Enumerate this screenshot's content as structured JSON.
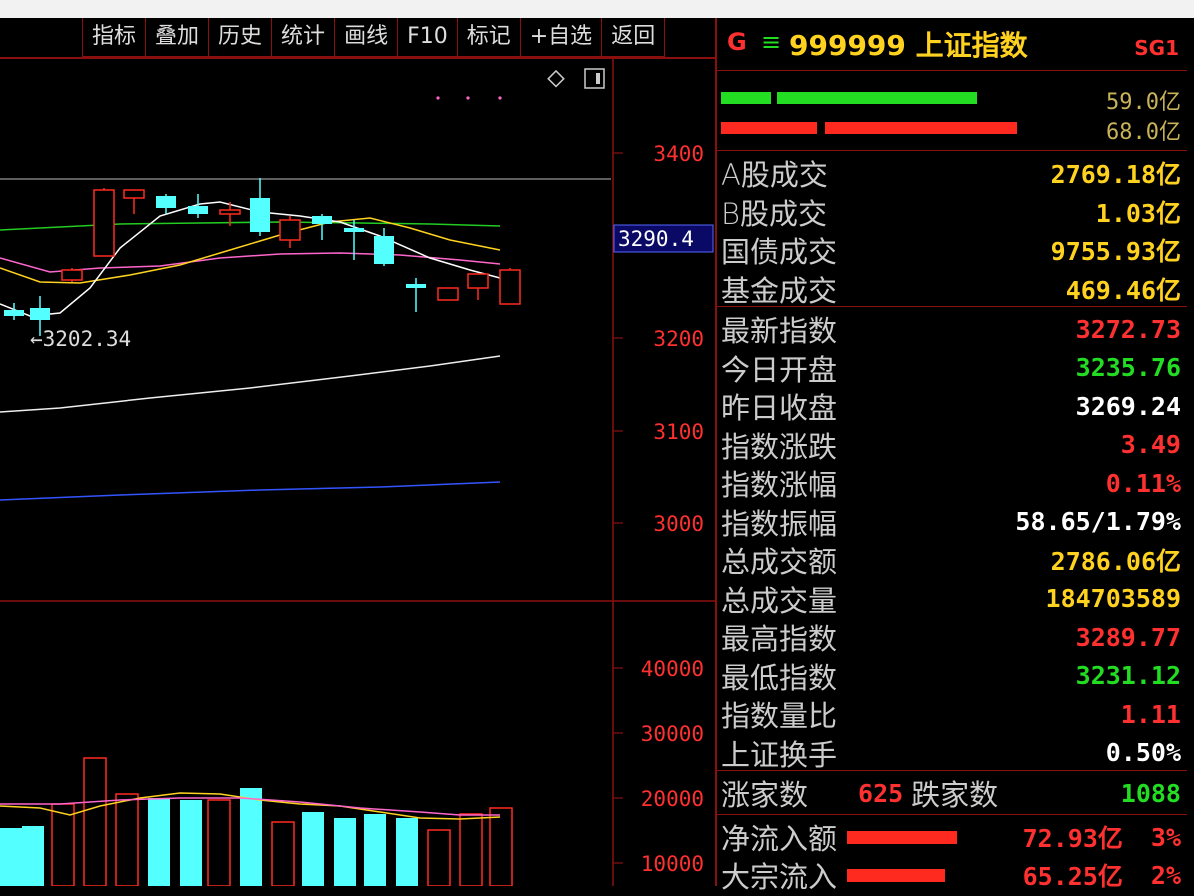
{
  "toolbar": {
    "buttons": [
      "指标",
      "叠加",
      "历史",
      "统计",
      "画线",
      "F10",
      "标记",
      "+自选",
      "返回"
    ]
  },
  "chart": {
    "price_ticks": [
      "3400",
      "3200",
      "3100",
      "3000"
    ],
    "current_price": "3290.4",
    "low_annotation": "←3202.34",
    "volume_ticks": [
      "40000",
      "30000",
      "20000",
      "10000"
    ],
    "colors": {
      "up": "#ff2a1f",
      "down": "#54ffff",
      "ma5": "#ffffff",
      "ma10": "#ffd21f",
      "ma20": "#ff66cc",
      "ma30": "#22cc22",
      "ma60": "#eeeeee",
      "ma120": "#3355ff"
    }
  },
  "header": {
    "g": "G",
    "menu": "≡",
    "title": "999999 上证指数",
    "sg": "SG1"
  },
  "ratio_bars": {
    "green_value": "59.0亿",
    "red_value": "68.0亿"
  },
  "turnover": [
    {
      "label": "A股成交",
      "value": "2769.18亿",
      "color": "#ffd21f"
    },
    {
      "label": "B股成交",
      "value": "1.03亿",
      "color": "#ffd21f"
    },
    {
      "label": "国债成交",
      "value": "9755.93亿",
      "color": "#ffd21f"
    },
    {
      "label": "基金成交",
      "value": "469.46亿",
      "color": "#ffd21f"
    }
  ],
  "index_stats": [
    {
      "label": "最新指数",
      "value": "3272.73",
      "color": "#ff3030"
    },
    {
      "label": "今日开盘",
      "value": "3235.76",
      "color": "#22dd22"
    },
    {
      "label": "昨日收盘",
      "value": "3269.24",
      "color": "#ffffff"
    },
    {
      "label": "指数涨跌",
      "value": "3.49",
      "color": "#ff3030"
    },
    {
      "label": "指数涨幅",
      "value": "0.11%",
      "color": "#ff3030"
    },
    {
      "label": "指数振幅",
      "value": "58.65/1.79%",
      "color": "#ffffff"
    },
    {
      "label": "总成交额",
      "value": "2786.06亿",
      "color": "#ffd21f"
    },
    {
      "label": "总成交量",
      "value": "184703589",
      "color": "#ffd21f"
    },
    {
      "label": "最高指数",
      "value": "3289.77",
      "color": "#ff3030"
    },
    {
      "label": "最低指数",
      "value": "3231.12",
      "color": "#22dd22"
    },
    {
      "label": "指数量比",
      "value": "1.11",
      "color": "#ff3030"
    },
    {
      "label": "上证换手",
      "value": "0.50%",
      "color": "#ffffff"
    }
  ],
  "advance_decline": {
    "up_label": "涨家数",
    "up_value": "625",
    "down_label": "跌家数",
    "down_value": "1088"
  },
  "flows": [
    {
      "label": "净流入额",
      "value": "72.93亿",
      "pct": "3%"
    },
    {
      "label": "大宗流入",
      "value": "65.25亿",
      "pct": "2%"
    }
  ]
}
